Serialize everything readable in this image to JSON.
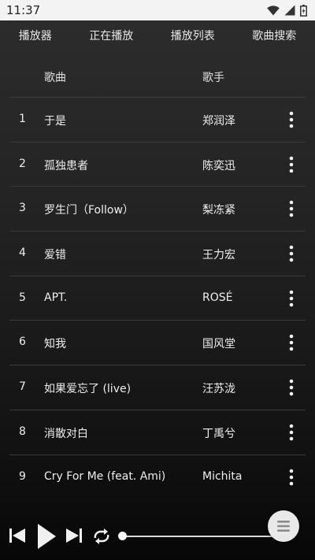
{
  "status_bar": {
    "time": "11:37"
  },
  "tabs": [
    {
      "label": "播放器"
    },
    {
      "label": "正在播放"
    },
    {
      "label": "播放列表"
    },
    {
      "label": "歌曲搜索"
    }
  ],
  "table_header": {
    "title": "歌曲",
    "artist": "歌手"
  },
  "songs": [
    {
      "num": "1",
      "title": "于是",
      "artist": "郑润泽"
    },
    {
      "num": "2",
      "title": "孤独患者",
      "artist": "陈奕迅"
    },
    {
      "num": "3",
      "title": "罗生门（Follow）",
      "artist": "梨冻紧"
    },
    {
      "num": "4",
      "title": "爱错",
      "artist": "王力宏"
    },
    {
      "num": "5",
      "title": "APT.",
      "artist": "ROSÉ"
    },
    {
      "num": "6",
      "title": "知我",
      "artist": "国风堂"
    },
    {
      "num": "7",
      "title": "如果爱忘了 (live)",
      "artist": "汪苏泷"
    },
    {
      "num": "8",
      "title": "消散对白",
      "artist": "丁禹兮"
    },
    {
      "num": "9",
      "title": "Cry For Me (feat. Ami)",
      "artist": "Michita"
    }
  ],
  "player": {
    "progress": 0.0,
    "icons": [
      "skip-previous-icon",
      "play-icon",
      "skip-next-icon",
      "repeat-icon",
      "menu-icon"
    ]
  },
  "colors": {
    "background": "#232323",
    "text": "#eeeeee",
    "status_bar": "#f3f3f3"
  }
}
